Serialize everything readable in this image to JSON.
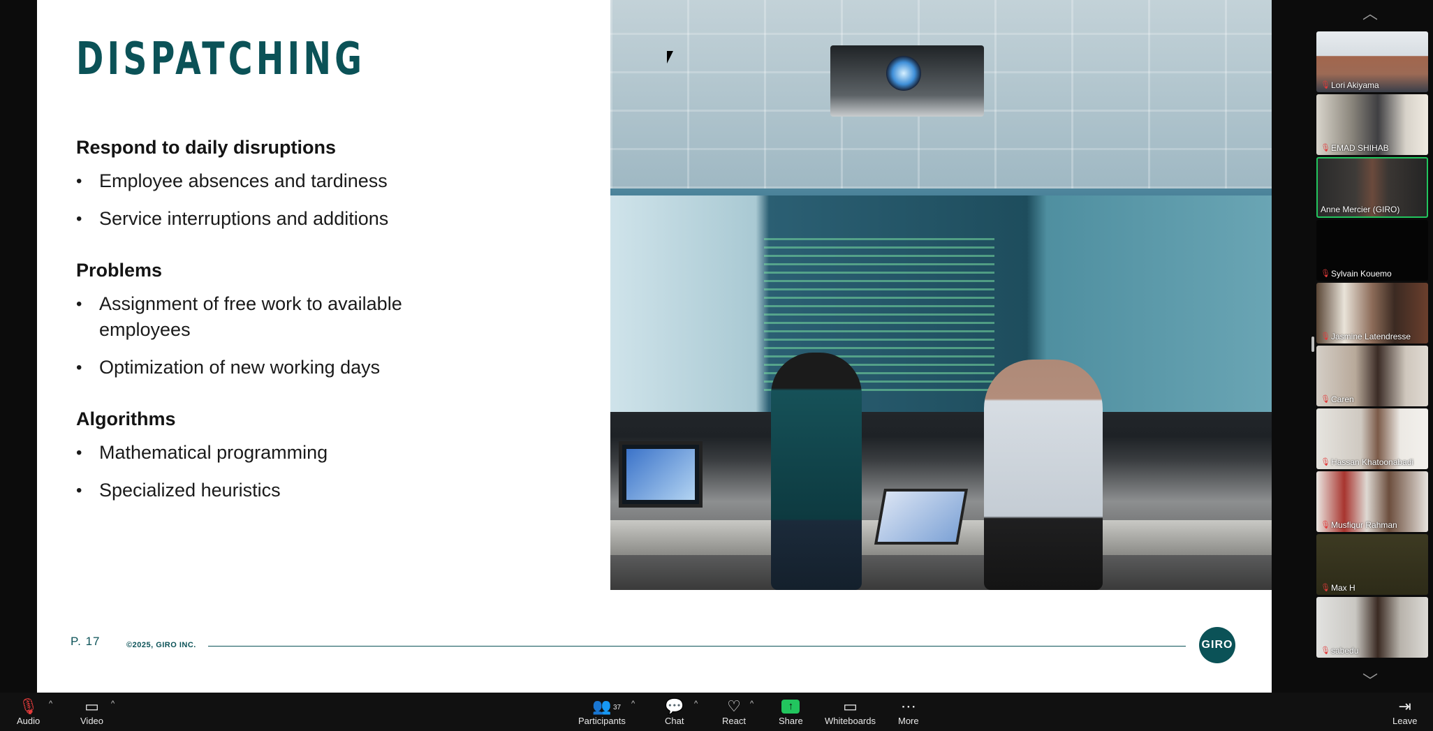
{
  "slide": {
    "title": "DISPATCHING",
    "sections": [
      {
        "heading": "Respond to daily disruptions",
        "bullets": [
          "Employee absences and tardiness",
          "Service interruptions and additions"
        ]
      },
      {
        "heading": "Problems",
        "bullets": [
          "Assignment of free work to available employees",
          "Optimization of new working days"
        ]
      },
      {
        "heading": "Algorithms",
        "bullets": [
          "Mathematical programming",
          "Specialized heuristics"
        ]
      }
    ],
    "bullet_char": "•",
    "page_number": "P. 17",
    "copyright": "©2025, GIRO INC.",
    "logo_text": "GIRO",
    "accent_color": "#0b5257"
  },
  "participants": {
    "scroll_up_icon": "chevron-up-icon",
    "scroll_down_icon": "chevron-down-icon",
    "tiles": [
      {
        "name": "Lori Akiyama",
        "muted": true,
        "active": false
      },
      {
        "name": "EMAD SHIHAB",
        "muted": true,
        "active": false
      },
      {
        "name": "Anne Mercier (GIRO)",
        "muted": false,
        "active": true
      },
      {
        "name": "Sylvain Kouemo",
        "muted": true,
        "active": false
      },
      {
        "name": "Jasmine Latendresse",
        "muted": true,
        "active": false
      },
      {
        "name": "Caren",
        "muted": true,
        "active": false
      },
      {
        "name": "Hassan Khatoonabadi",
        "muted": true,
        "active": false
      },
      {
        "name": "Musfiqur Rahman",
        "muted": true,
        "active": false
      },
      {
        "name": "Max H",
        "muted": true,
        "active": false
      },
      {
        "name": "sabedu",
        "muted": true,
        "active": false
      }
    ]
  },
  "toolbar": {
    "audio_label": "Audio",
    "video_label": "Video",
    "participants_label": "Participants",
    "participants_count": "37",
    "chat_label": "Chat",
    "react_label": "React",
    "share_label": "Share",
    "whiteboards_label": "Whiteboards",
    "more_label": "More",
    "leave_label": "Leave",
    "share_color": "#22c55e",
    "muted_color": "#e23b3b"
  }
}
